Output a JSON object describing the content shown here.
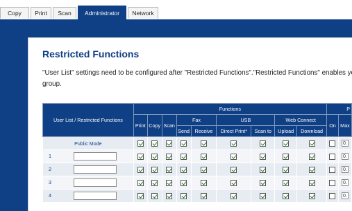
{
  "tabs": [
    {
      "label": "Copy",
      "active": false
    },
    {
      "label": "Print",
      "active": false
    },
    {
      "label": "Scan",
      "active": false
    },
    {
      "label": "Administrator",
      "active": true
    },
    {
      "label": "Network",
      "active": false
    }
  ],
  "page": {
    "title": "Restricted Functions",
    "description_line1": "\"User List\" settings need to be configured after \"Restricted Functions\".\"Restricted Functions\" enables yo",
    "description_line2": "group."
  },
  "table": {
    "header": {
      "user_list_col": "User List / Restricted Functions",
      "functions": "Functions",
      "right_group_cut": "P",
      "print": "Print",
      "copy": "Copy",
      "scan": "Scan",
      "fax": "Fax",
      "usb": "USB",
      "web_connect": "Web Connect",
      "fax_send": "Send",
      "fax_receive": "Receive",
      "usb_direct_print": "Direct Print*",
      "usb_scan_to": "Scan to",
      "web_upload": "Upload",
      "web_download": "Download",
      "on": "On",
      "max_cut": "Max"
    },
    "rows": [
      {
        "label": "Public Mode",
        "checks": [
          true,
          true,
          true,
          true,
          true,
          true,
          true,
          true,
          true
        ],
        "on": false,
        "max_value": "0."
      },
      {
        "label": "1",
        "checks": [
          true,
          true,
          true,
          true,
          true,
          true,
          true,
          true,
          true
        ],
        "on": false,
        "max_value": "0."
      },
      {
        "label": "2",
        "checks": [
          true,
          true,
          true,
          true,
          true,
          true,
          true,
          true,
          true
        ],
        "on": false,
        "max_value": "0."
      },
      {
        "label": "3",
        "checks": [
          true,
          true,
          true,
          true,
          true,
          true,
          true,
          true,
          true
        ],
        "on": false,
        "max_value": "0."
      },
      {
        "label": "4",
        "checks": [
          true,
          true,
          true,
          true,
          true,
          true,
          true,
          true,
          true
        ],
        "on": false,
        "max_value": "0."
      }
    ]
  },
  "colors": {
    "brand_blue": "#0f3f85",
    "row_bg": "#e7ecf3",
    "check_green": "#1f7a1f"
  }
}
